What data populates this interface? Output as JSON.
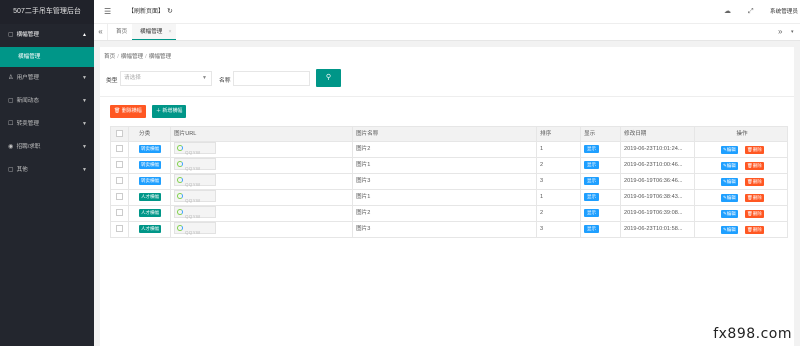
{
  "app": {
    "title": "507二手吊车管理后台"
  },
  "sidebar": {
    "items": [
      {
        "label": "横幅管理",
        "icon": "document-icon",
        "open": true,
        "sub": [
          "横幅管理"
        ]
      },
      {
        "label": "用户管理",
        "icon": "user-icon"
      },
      {
        "label": "新闻动态",
        "icon": "document-icon"
      },
      {
        "label": "转卖管理",
        "icon": "chat-icon"
      },
      {
        "label": "招聘/求职",
        "icon": "target-icon"
      },
      {
        "label": "其他",
        "icon": "document-icon"
      }
    ]
  },
  "header": {
    "toggle_icon": "☰",
    "refresh_label": "【刷新页面】",
    "refresh_icon": "↻",
    "theme_icon": "☁",
    "fullscreen_icon": "⤢",
    "admin_label": "系统管理员"
  },
  "tabs": {
    "prev": "«",
    "home": "首页",
    "active": "横幅管理",
    "close": "×",
    "next": "»",
    "more": "▾"
  },
  "breadcrumb": [
    "首页",
    "横幅管理",
    "横幅管理"
  ],
  "filter": {
    "type_label": "类型",
    "type_placeholder": "请选择",
    "name_label": "名称",
    "name_value": "",
    "search_icon": "⚲"
  },
  "buttons": {
    "batch_delete": "删除横幅",
    "add": "新增横幅"
  },
  "table": {
    "headers": [
      "",
      "分类",
      "图片URL",
      "图片名称",
      "排序",
      "显示",
      "修改日期",
      "操作"
    ],
    "rows": [
      {
        "category": "转卖横幅",
        "cat_color": "blue",
        "image": "QQYW",
        "name": "图片2",
        "order": "1",
        "show": "显示",
        "date": "2019-06-23T10:01:24...",
        "edit": "✎编辑",
        "delete": "删除"
      },
      {
        "category": "转卖横幅",
        "cat_color": "blue",
        "image": "QQYW",
        "name": "图片1",
        "order": "2",
        "show": "显示",
        "date": "2019-06-23T10:00:46...",
        "edit": "✎编辑",
        "delete": "删除"
      },
      {
        "category": "转卖横幅",
        "cat_color": "blue",
        "image": "QQYW",
        "name": "图片3",
        "order": "3",
        "show": "显示",
        "date": "2019-06-19T06:36:46...",
        "edit": "✎编辑",
        "delete": "删除"
      },
      {
        "category": "人才横幅",
        "cat_color": "green",
        "image": "QQYW",
        "name": "图片1",
        "order": "1",
        "show": "显示",
        "date": "2019-06-19T06:38:43...",
        "edit": "✎编辑",
        "delete": "删除"
      },
      {
        "category": "人才横幅",
        "cat_color": "green",
        "image": "QQYW",
        "name": "图片2",
        "order": "2",
        "show": "显示",
        "date": "2019-06-19T06:39:08...",
        "edit": "✎编辑",
        "delete": "删除"
      },
      {
        "category": "人才横幅",
        "cat_color": "green",
        "image": "QQYW",
        "name": "图片3",
        "order": "3",
        "show": "显示",
        "date": "2019-06-23T10:01:58...",
        "edit": "✎编辑",
        "delete": "删除"
      }
    ]
  },
  "watermark": "fx898.com",
  "colors": {
    "sidebar": "#23262e",
    "primary": "#009688",
    "danger": "#ff5722",
    "info": "#1e9fff"
  }
}
